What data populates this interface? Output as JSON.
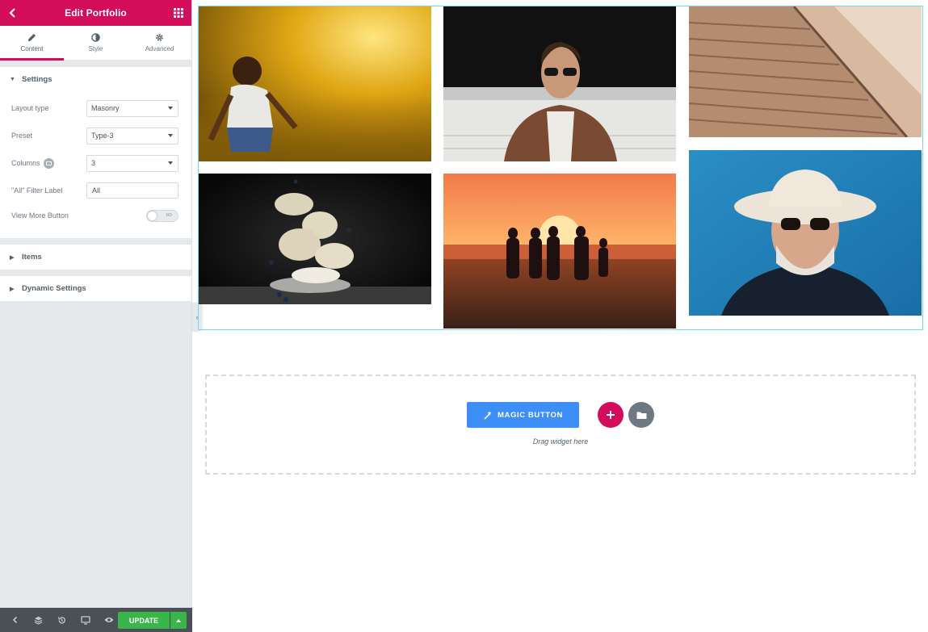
{
  "header": {
    "title": "Edit Portfolio"
  },
  "tabs": [
    {
      "label": "Content",
      "icon": "pencil-icon"
    },
    {
      "label": "Style",
      "icon": "half-circle-icon"
    },
    {
      "label": "Advanced",
      "icon": "gear-icon"
    }
  ],
  "settings": {
    "title": "Settings",
    "layout_type": {
      "label": "Layout type",
      "value": "Masonry"
    },
    "preset": {
      "label": "Preset",
      "value": "Type-3"
    },
    "columns": {
      "label": "Columns",
      "value": "3"
    },
    "filter_label": {
      "label": "\"All\" Filter Label",
      "value": "All"
    },
    "view_more": {
      "label": "View More Button",
      "toggle": "NO"
    }
  },
  "sections": {
    "items": "Items",
    "dynamic": "Dynamic Settings"
  },
  "footer": {
    "update": "UPDATE"
  },
  "canvas": {
    "magic_button": "MAGIC BUTTON",
    "drag_text": "Drag widget here"
  },
  "colors": {
    "brand": "#d30c5c",
    "panel_bg": "#e6e9ec",
    "update_green": "#39b54a",
    "magic_blue": "#3e8ef7",
    "selection_outline": "#71d7f7"
  },
  "gallery": {
    "images": [
      "child-running-through-sprinkler-photo",
      "man-in-sunglasses-brown-jacket-photo",
      "concrete-stairs-photo",
      "floating-meringue-cookies-photo",
      "group-silhouette-at-sunset-beach-photo",
      "old-man-in-cowboy-hat-photo"
    ]
  }
}
